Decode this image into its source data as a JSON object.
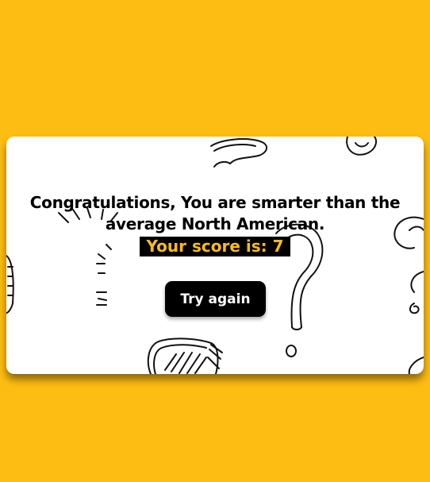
{
  "colors": {
    "background": "#FEBD12",
    "card": "#FFFFFF",
    "score_bg": "#000000",
    "score_text": "#FEBD12",
    "button_bg": "#000000",
    "button_text": "#FFFFFF"
  },
  "result": {
    "message": "Congratulations, You are smarter than the average North American.",
    "score_label": "Your score is: 7",
    "try_again_label": "Try again"
  },
  "decorations": {
    "icons": [
      "question-mark-doodle-icon",
      "sparkle-lines-icon",
      "hatched-shape-icon"
    ]
  }
}
